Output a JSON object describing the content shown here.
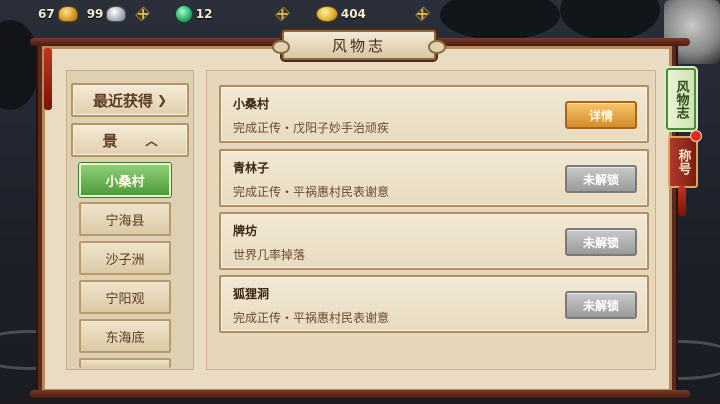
{
  "currency": [
    {
      "icon": "gold-ingot-icon",
      "value": "67"
    },
    {
      "icon": "silver-ingot-icon",
      "value": "99"
    },
    {
      "icon": "jade-icon",
      "value": "12"
    },
    {
      "icon": "gold-coin-icon",
      "value": "404"
    }
  ],
  "title": "风物志",
  "sidebar": {
    "recent_label": "最近获得",
    "scene_label": "景",
    "items": [
      "小桑村",
      "宁海县",
      "沙子洲",
      "宁阳观",
      "东海底"
    ]
  },
  "entries": [
    {
      "name": "小桑村",
      "desc": "完成正传・戊阳子妙手治顽疾",
      "button": "详情",
      "state": "unlocked"
    },
    {
      "name": "青林子",
      "desc": "完成正传・平祸惠村民表谢意",
      "button": "未解锁",
      "state": "locked"
    },
    {
      "name": "牌坊",
      "desc": "世界几率掉落",
      "button": "未解锁",
      "state": "locked"
    },
    {
      "name": "狐狸洞",
      "desc": "完成正传・平祸惠村民表谢意",
      "button": "未解锁",
      "state": "locked"
    }
  ],
  "side_tabs": {
    "active": "风物志",
    "inactive": "称号"
  },
  "colors": {
    "frame": "#5a2a1c",
    "active_green": "#4e9a3a",
    "detail_orange": "#d58c2a",
    "locked_gray": "#9a9a9a",
    "notification_red": "#e02a1a"
  }
}
